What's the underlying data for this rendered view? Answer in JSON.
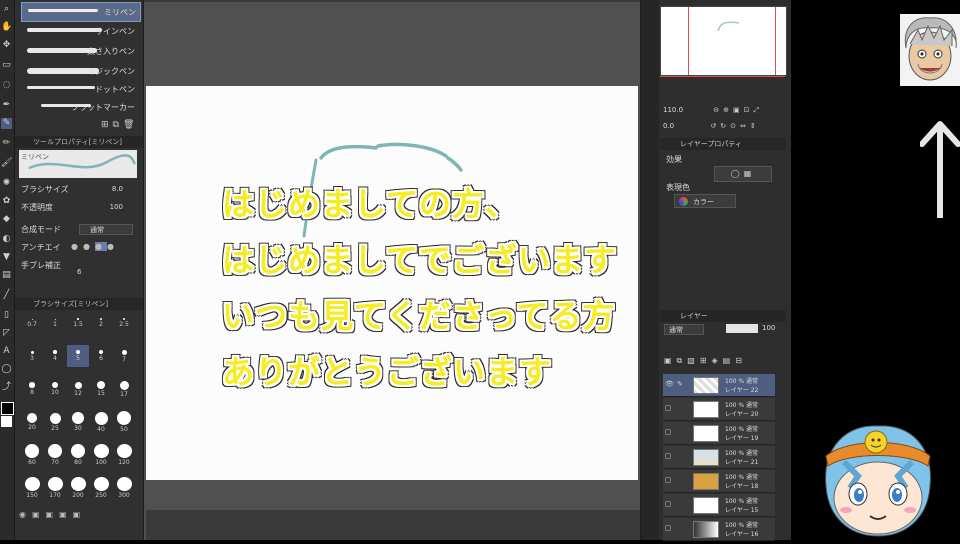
{
  "left_panel": {
    "pens": [
      {
        "label": "ミリペン"
      },
      {
        "label": "サインペン"
      },
      {
        "label": "太さ入りペン"
      },
      {
        "label": "マジックペン"
      },
      {
        "label": "ドットペン"
      },
      {
        "label": "フラットマーカー"
      }
    ],
    "tool_property_title": "ツールプロパティ[ミリペン]",
    "brush_preview_label": "ミリペン",
    "props": {
      "brush_size_label": "ブラシサイズ",
      "brush_size_value": "8.0",
      "opacity_label": "不透明度",
      "opacity_value": "100",
      "blend_mode_label": "合成モード",
      "blend_mode_value": "通常",
      "antialias_label": "アンチエイ",
      "stabilization_label": "手ブレ補正",
      "stabilization_value": "6"
    },
    "brush_size_title": "ブラシサイズ[ミリペン]",
    "brush_sizes": [
      "0.7",
      "1",
      "1.5",
      "2",
      "2.5",
      "3",
      "4",
      "5",
      "6",
      "7",
      "8",
      "10",
      "12",
      "15",
      "17",
      "20",
      "25",
      "30",
      "40",
      "50",
      "60",
      "70",
      "80",
      "100",
      "120",
      "150",
      "170",
      "200",
      "250",
      "300"
    ]
  },
  "caption": {
    "line1": "はじめましての方、",
    "line2": "はじめましてでございます",
    "line3": "いつも見てくださってる方",
    "line4": "ありがとうございます"
  },
  "right_panel": {
    "zoom_value": "110.0",
    "rotate_value": "0.0",
    "layer_property_tab": "レイヤープロパティ",
    "effect_label": "効果",
    "express_color_label": "表現色",
    "express_color_value": "カラー",
    "layer_tab": "レイヤー",
    "blend_mode_value": "通常",
    "opacity_value": "100",
    "layers": [
      {
        "mode": "100 % 通常",
        "name": "レイヤー 22"
      },
      {
        "mode": "100 % 通常",
        "name": "レイヤー 20"
      },
      {
        "mode": "100 % 通常",
        "name": "レイヤー 19"
      },
      {
        "mode": "100 % 通常",
        "name": "レイヤー 21"
      },
      {
        "mode": "100 % 通常",
        "name": "レイヤー 18"
      },
      {
        "mode": "100 % 通常",
        "name": "レイヤー 15"
      },
      {
        "mode": "100 % 通常",
        "name": "レイヤー 16"
      }
    ]
  },
  "colors": {
    "caption_fill": "#f7eb22",
    "sketch_stroke": "#7fb5b5",
    "selected_layer": "#4d5e80"
  }
}
